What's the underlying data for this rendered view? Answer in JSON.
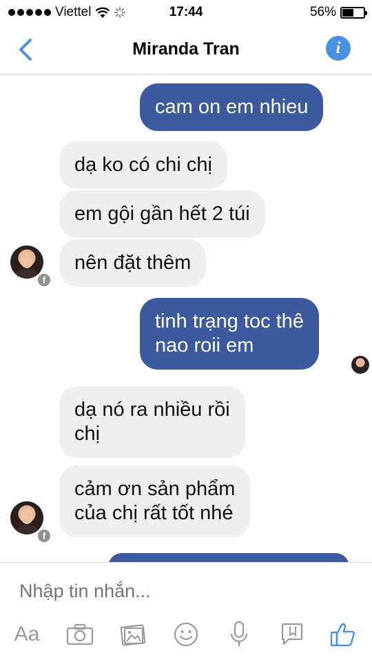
{
  "status": {
    "carrier": "Viettel",
    "time": "17:44",
    "battery_text": "56%",
    "battery_level": 0.56
  },
  "nav": {
    "title": "Miranda Tran",
    "back_icon": "chevron-left-icon",
    "info_icon": "info-icon",
    "info_glyph": "i"
  },
  "messages": [
    {
      "from": "me",
      "text": "cam on em nhieu"
    },
    {
      "from": "them",
      "text": "dạ ko có chi chị"
    },
    {
      "from": "them",
      "text": "em gội gần hết 2 túi"
    },
    {
      "from": "them",
      "text": "nên đặt thêm"
    },
    {
      "from": "me",
      "line1": "tinh trạng toc thê",
      "line2": "nao roii em"
    },
    {
      "from": "them",
      "line1": "dạ nó ra nhiều rồi",
      "line2": "chị"
    },
    {
      "from": "them",
      "line1": "cảm ơn sản phẩm",
      "line2": "của chị rất tốt nhé"
    }
  ],
  "badge_glyph": "f",
  "composer": {
    "placeholder": "Nhập tin nhắn...",
    "text_button": "Aa",
    "tools": [
      "text-format-icon",
      "camera-icon",
      "photo-gallery-icon",
      "emoji-icon",
      "microphone-icon",
      "sticker-icon",
      "like-icon"
    ]
  },
  "colors": {
    "outgoing_bubble": "#3d5a9e",
    "incoming_bubble": "#efefef",
    "accent": "#4a90e2"
  }
}
